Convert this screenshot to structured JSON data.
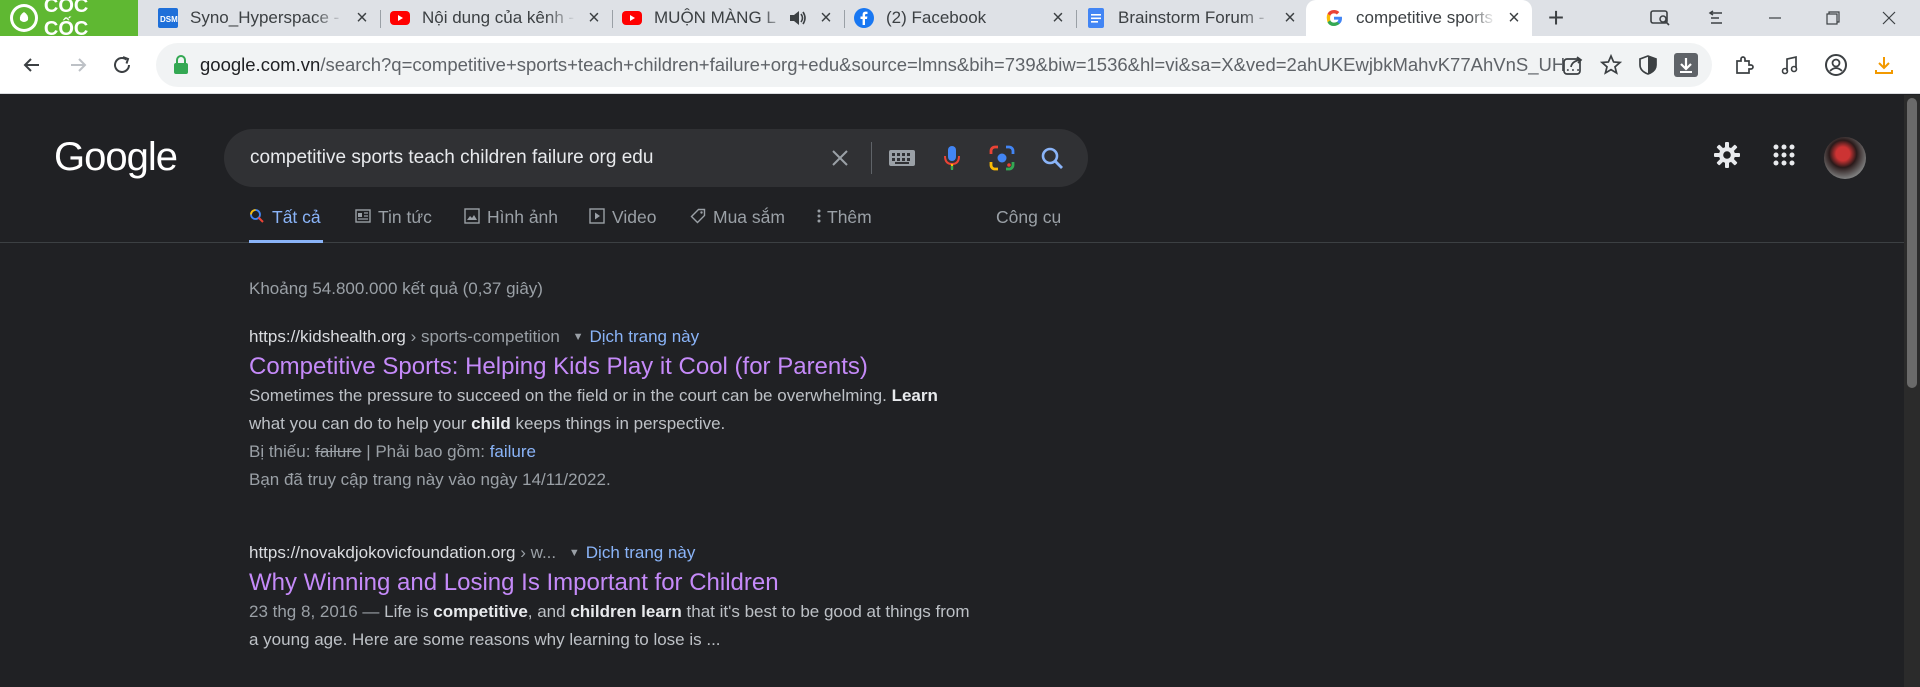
{
  "browser": {
    "brand": "CỐC CỐC",
    "tabs": [
      {
        "title": "Syno_Hyperspace - S",
        "icon": "dsm-icon"
      },
      {
        "title": "Nội dung của kênh -",
        "icon": "youtube-icon"
      },
      {
        "title": "MUỘN MÀNG L",
        "icon": "youtube-icon",
        "audio": true
      },
      {
        "title": "(2) Facebook",
        "icon": "facebook-icon"
      },
      {
        "title": "Brainstorm Forum -",
        "icon": "docs-icon"
      },
      {
        "title": "competitive sports t",
        "icon": "google-icon",
        "active": true
      }
    ],
    "url_host": "google.com.vn",
    "url_rest": "/search?q=competitive+sports+teach+children+failure+org+edu&source=lmns&bih=739&biw=1536&hl=vi&sa=X&ved=2ahUKEwjbkMahvK77AhVnS_UH..."
  },
  "google": {
    "logo": "Google",
    "query": "competitive sports teach children failure org edu",
    "tabs": [
      {
        "label": "Tất cả",
        "icon": "search-icon",
        "active": true
      },
      {
        "label": "Tin tức",
        "icon": "news-icon"
      },
      {
        "label": "Hình ảnh",
        "icon": "image-icon"
      },
      {
        "label": "Video",
        "icon": "video-icon"
      },
      {
        "label": "Mua sắm",
        "icon": "tag-icon"
      },
      {
        "label": "Thêm",
        "icon": "more-vert-icon"
      },
      {
        "label": "Công cụ",
        "icon": ""
      }
    ],
    "stats": "Khoảng 54.800.000 kết quả (0,37 giây)",
    "results": [
      {
        "site": "https://kidshealth.org",
        "path": " › sports-competition",
        "translate": "Dịch trang này",
        "title": "Competitive Sports: Helping Kids Play it Cool (for Parents)",
        "snippet_1a": "Sometimes the pressure to succeed on the field or in the court can be overwhelming. ",
        "snippet_1b": "Learn",
        "snippet_2a": "what you can do to help your ",
        "snippet_2b": "child",
        "snippet_2c": " keeps things in perspective.",
        "missing_label": "Bị thiếu: ",
        "missing_word": "failure",
        "must_include_label": " | Phải bao gồm: ",
        "must_include_word": "failure",
        "visited": "Bạn đã truy cập trang này vào ngày 14/11/2022."
      },
      {
        "site": "https://novakdjokovicfoundation.org",
        "path": " › w...",
        "translate": "Dịch trang này",
        "title": "Why Winning and Losing Is Important for Children",
        "date": "23 thg 8, 2016 — ",
        "snippet_1a": "Life is ",
        "snippet_1b": "competitive",
        "snippet_1c": ", and ",
        "snippet_1d": "children learn",
        "snippet_1e": " that it's best to be good at things from",
        "snippet_2": "a young age. Here are some reasons why learning to lose is ..."
      }
    ]
  },
  "colors": {
    "brand_green": "#5fb832",
    "google_bg": "#202124",
    "link_visited": "#c58af9",
    "link_blue": "#8ab4f8"
  }
}
